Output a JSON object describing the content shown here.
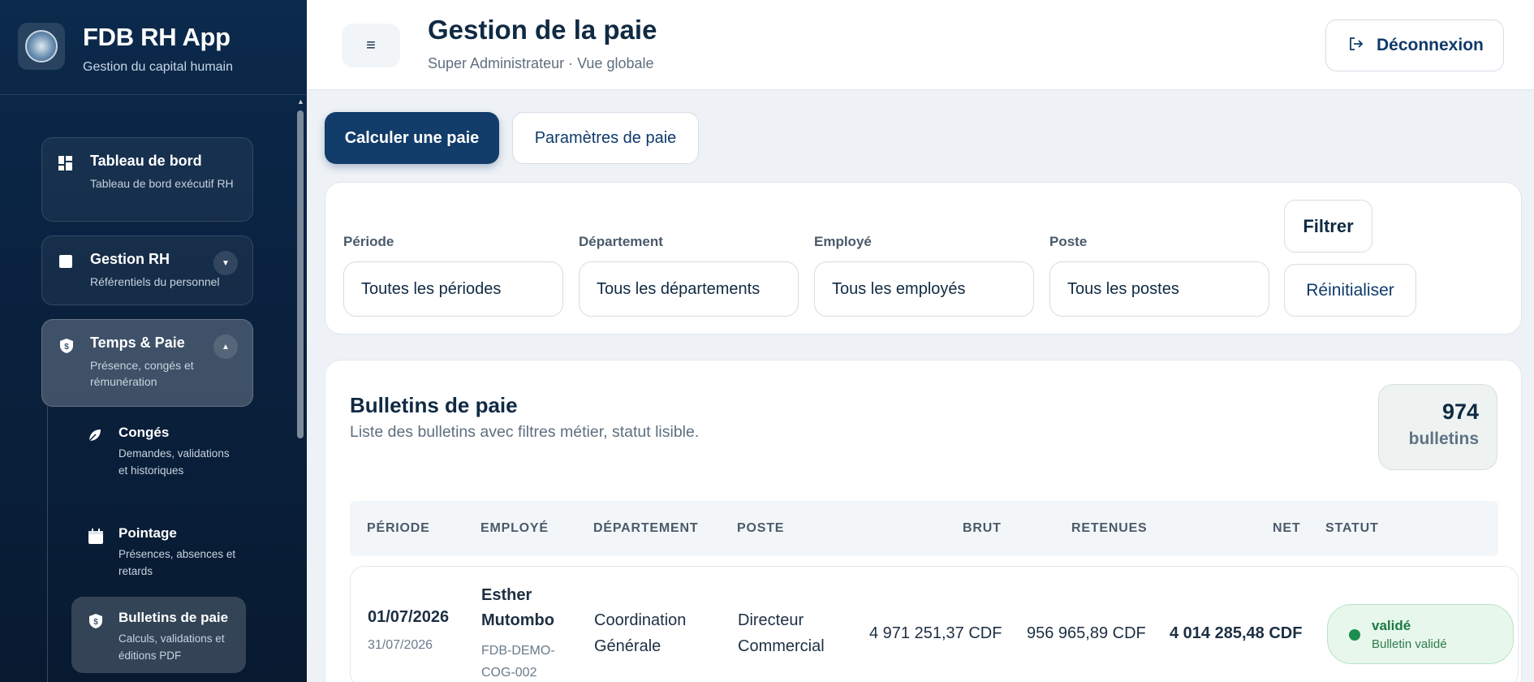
{
  "brand": {
    "title": "FDB RH App",
    "subtitle": "Gestion du capital humain"
  },
  "sidebar": {
    "items": [
      {
        "label": "Tableau de bord",
        "sub": "Tableau de bord exécutif RH",
        "icon": "dashboard-icon"
      },
      {
        "label": "Gestion RH",
        "sub": "Référentiels du personnel",
        "icon": "square-icon"
      },
      {
        "label": "Temps & Paie",
        "sub": "Présence, congés et rémunération",
        "icon": "money-shield-icon"
      }
    ],
    "subitems": [
      {
        "label": "Congés",
        "sub": "Demandes, validations et historiques",
        "icon": "leaf-icon"
      },
      {
        "label": "Pointage",
        "sub": "Présences, absences et retards",
        "icon": "calendar-icon"
      },
      {
        "label": "Bulletins de paie",
        "sub": "Calculs, validations et éditions PDF",
        "icon": "money-shield-icon"
      }
    ]
  },
  "header": {
    "title": "Gestion de la paie",
    "subtitle": "Super Administrateur · Vue globale",
    "logout_label": "Déconnexion"
  },
  "tabs": {
    "primary": "Calculer une paie",
    "secondary": "Paramètres de paie"
  },
  "filters": {
    "periode_label": "Période",
    "periode_value": "Toutes les périodes",
    "departement_label": "Département",
    "departement_value": "Tous les départements",
    "employe_label": "Employé",
    "employe_value": "Tous les employés",
    "poste_label": "Poste",
    "poste_value": "Tous les postes",
    "filter_button": "Filtrer",
    "reset_button": "Réinitialiser"
  },
  "bulletins": {
    "title": "Bulletins de paie",
    "subtitle": "Liste des bulletins avec filtres métier, statut lisible.",
    "count": "974",
    "count_label": "bulletins",
    "columns": [
      "PÉRIODE",
      "EMPLOYÉ",
      "DÉPARTEMENT",
      "POSTE",
      "BRUT",
      "RETENUES",
      "NET",
      "STATUT"
    ],
    "rows": [
      {
        "periode_start": "01/07/2026",
        "periode_end": "31/07/2026",
        "employe_name_1": "Esther",
        "employe_name_2": "Mutombo",
        "employe_code_1": "FDB-DEMO-",
        "employe_code_2": "COG-002",
        "departement_1": "Coordination",
        "departement_2": "Générale",
        "poste_1": "Directeur",
        "poste_2": "Commercial",
        "brut": "4 971 251,37 CDF",
        "retenues": "956 965,89 CDF",
        "net": "4 014 285,48 CDF",
        "statut": "validé",
        "statut_detail": "Bulletin validé"
      }
    ]
  },
  "colors": {
    "primary": "#123c6a",
    "sidebar_bg": "#0a2240",
    "success": "#1e8e4e"
  }
}
